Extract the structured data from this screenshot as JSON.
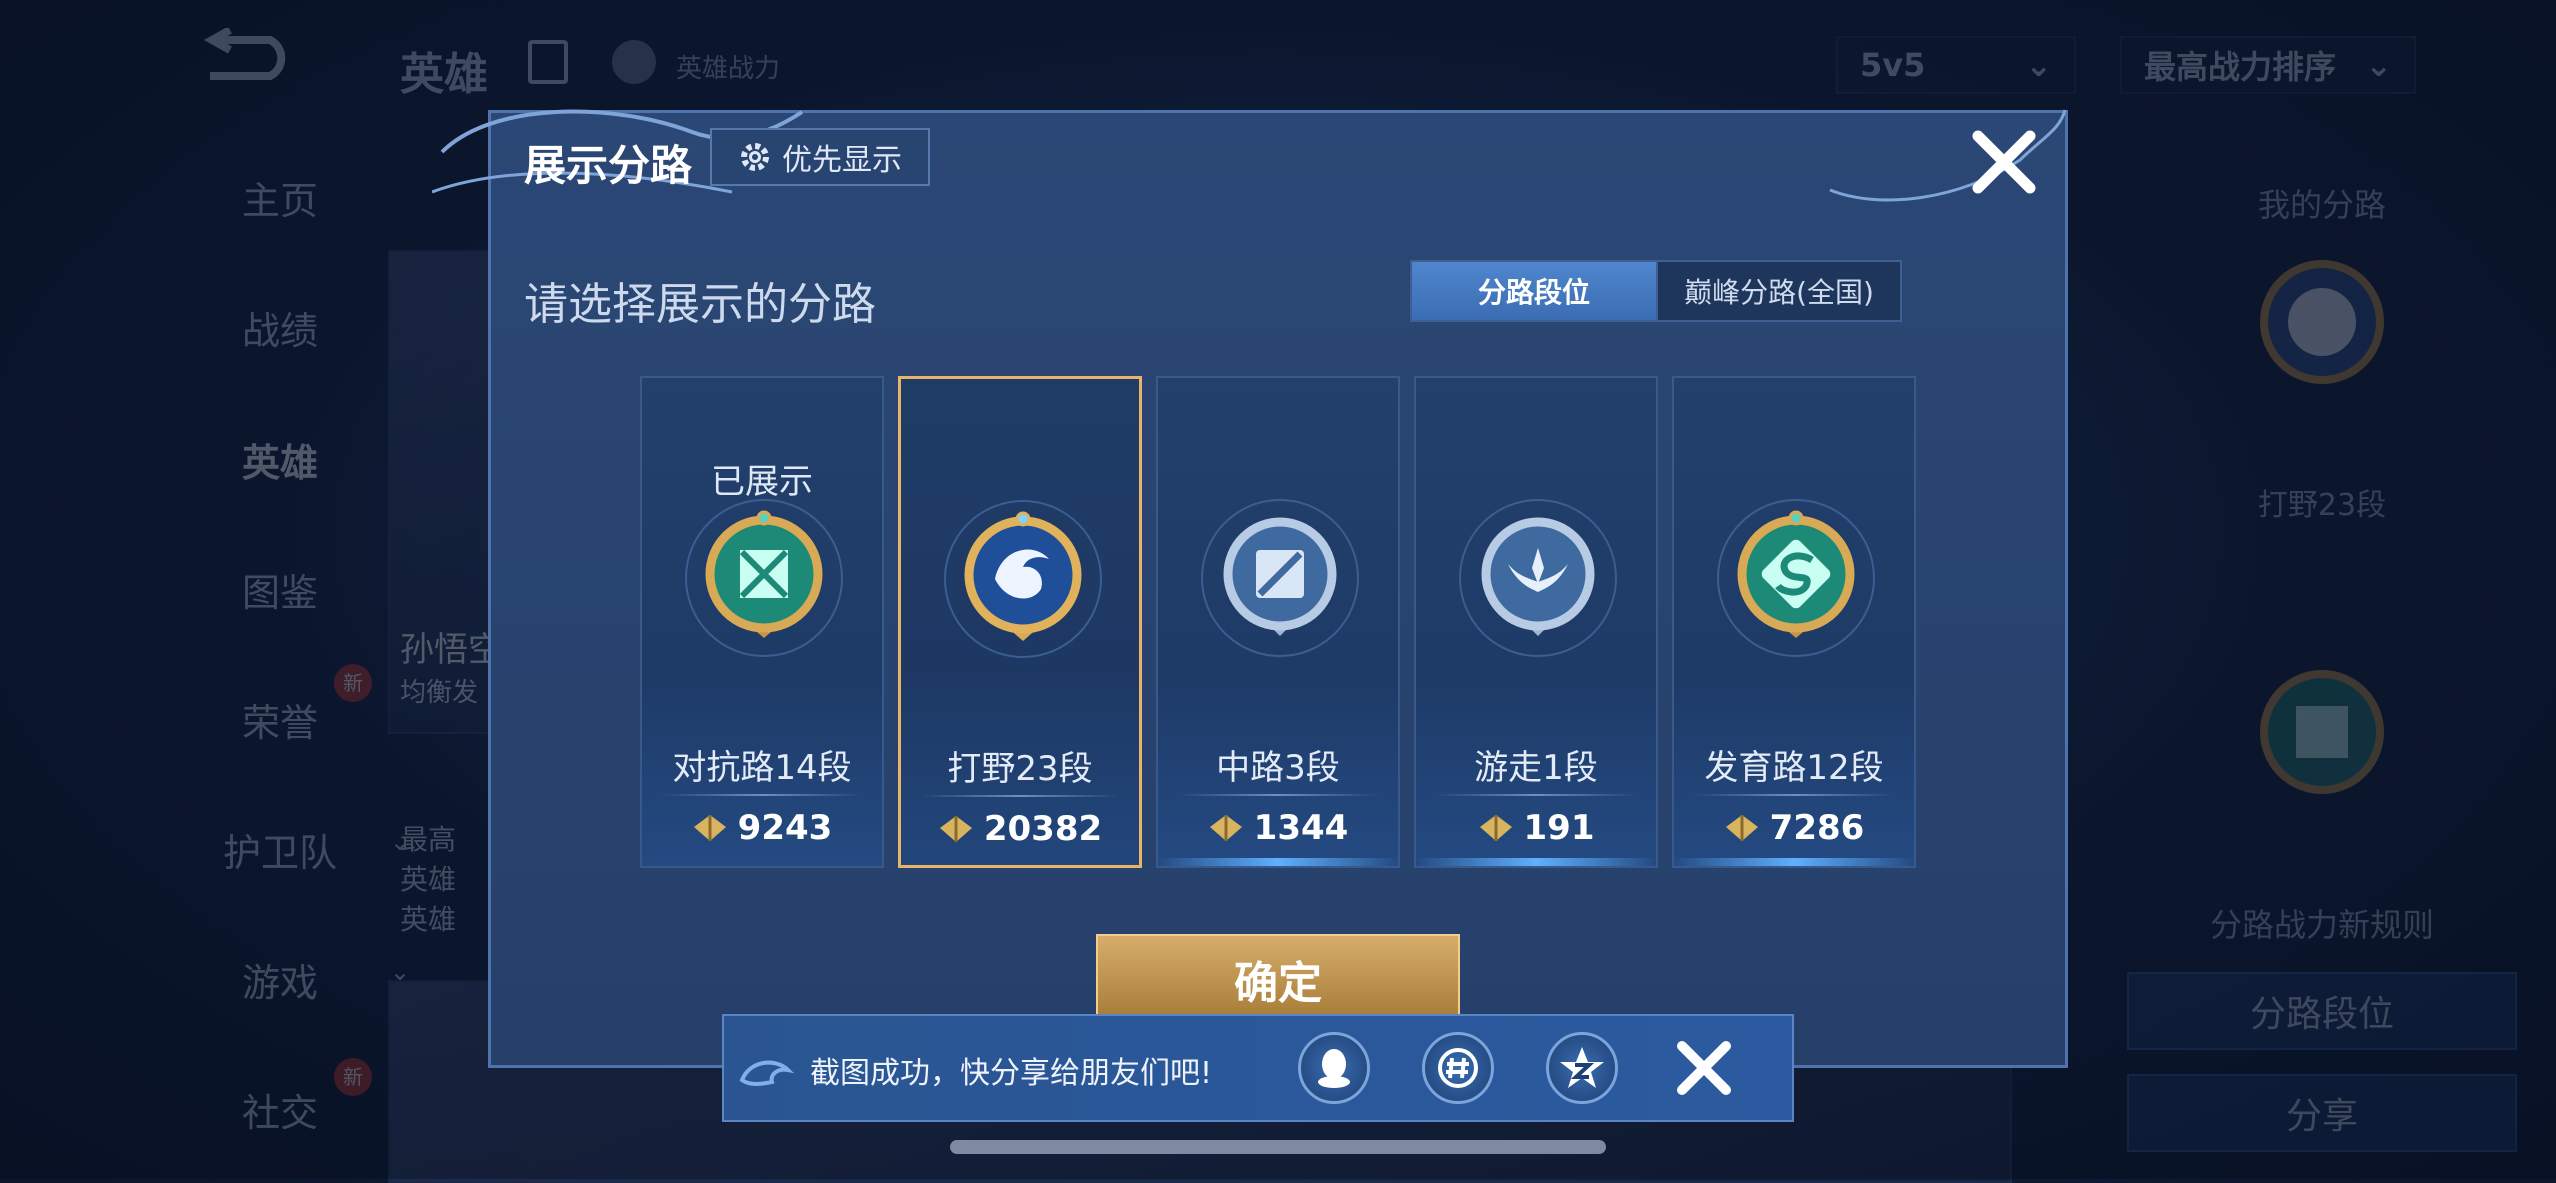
{
  "background": {
    "title": "英雄",
    "power_label": "英雄战力",
    "mode_select": "5v5",
    "sort_select": "最高战力排序",
    "nav": [
      {
        "label": "主页"
      },
      {
        "label": "战绩"
      },
      {
        "label": "英雄"
      },
      {
        "label": "图鉴"
      },
      {
        "label": "荣誉"
      },
      {
        "label": "护卫队"
      },
      {
        "label": "游戏"
      },
      {
        "label": "社交"
      }
    ],
    "new_badge": "新",
    "hero_name": "孙悟空",
    "hero_tag": "均衡发",
    "hero_info": [
      "最高",
      "英雄",
      "英雄"
    ],
    "right": {
      "title": "我的分路",
      "rank": "打野23段",
      "rules": "分路战力新规则",
      "lane_rank_btn": "分路段位",
      "share_btn": "分享"
    }
  },
  "modal": {
    "title": "展示分路",
    "priority_btn": "优先显示",
    "subtitle": "请选择展示的分路",
    "tabs": [
      "分路段位",
      "巅峰分路(全国)"
    ],
    "cards": [
      {
        "shown": "已展示",
        "rank": "对抗路14段",
        "score": "9243",
        "emblem": "clash-lane-emblem",
        "selected": false
      },
      {
        "shown": "",
        "rank": "打野23段",
        "score": "20382",
        "emblem": "jungle-emblem",
        "selected": true
      },
      {
        "shown": "",
        "rank": "中路3段",
        "score": "1344",
        "emblem": "mid-lane-emblem",
        "selected": false
      },
      {
        "shown": "",
        "rank": "游走1段",
        "score": "191",
        "emblem": "roam-emblem",
        "selected": false
      },
      {
        "shown": "",
        "rank": "发育路12段",
        "score": "7286",
        "emblem": "farm-lane-emblem",
        "selected": false
      }
    ],
    "confirm": "确定"
  },
  "toast": {
    "text": "截图成功，快分享给朋友们吧!",
    "share_icons": [
      "qq-icon",
      "wechat-moments-icon",
      "qzone-icon"
    ]
  },
  "colors": {
    "accent_gold": "#e7b46a",
    "selected_tab": "#4f86cd",
    "panel": "#26406a"
  }
}
